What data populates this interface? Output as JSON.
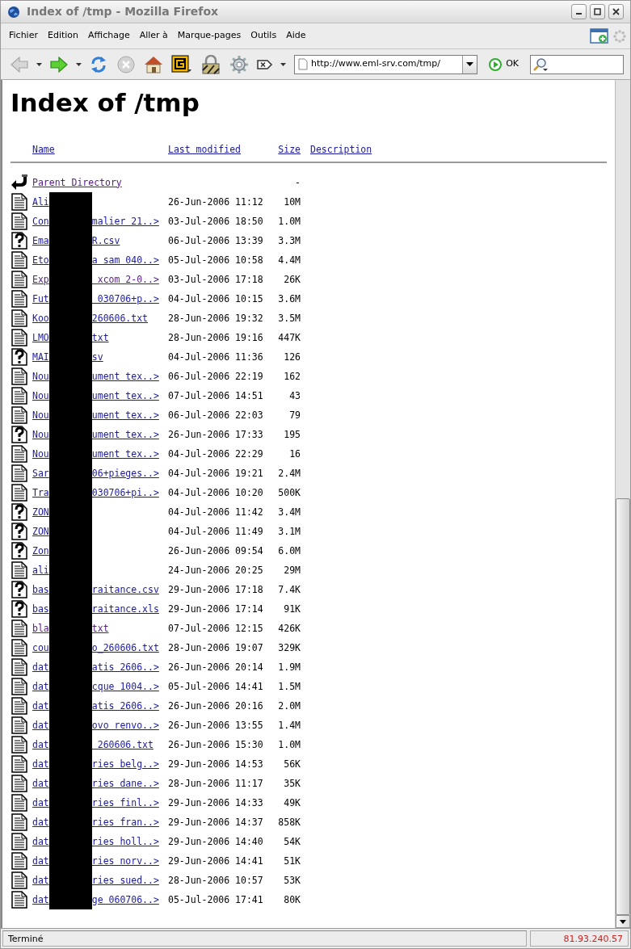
{
  "window": {
    "title": "Index of /tmp - Mozilla Firefox"
  },
  "menu": [
    "Fichier",
    "Edition",
    "Affichage",
    "Aller à",
    "Marque-pages",
    "Outils",
    "Aide"
  ],
  "toolbar": {
    "buttons": [
      {
        "kind": "back",
        "disabled": true
      },
      {
        "kind": "forward",
        "disabled": false
      },
      {
        "kind": "reload",
        "disabled": false
      },
      {
        "kind": "stop",
        "disabled": true
      },
      {
        "kind": "home",
        "disabled": false
      }
    ],
    "url": "http://www.eml-srv.com/tmp/",
    "go_label": "OK"
  },
  "page": {
    "heading": "Index of /tmp",
    "columns": [
      "Name",
      "Last modified",
      "Size",
      "Description"
    ],
    "rows": [
      {
        "kind": "back",
        "name_start": "Parent Directory",
        "name_end": "",
        "redacted": false,
        "visited": true,
        "modified": "",
        "size": "-"
      },
      {
        "kind": "text",
        "name_start": "Ali",
        "name_end": "",
        "redacted": true,
        "visited": false,
        "modified": "26-Jun-2006 11:12",
        "size": "10M"
      },
      {
        "kind": "text",
        "name_start": "Con",
        "name_end": "malier 21..>",
        "redacted": true,
        "visited": false,
        "modified": "03-Jul-2006 18:50",
        "size": "1.0M"
      },
      {
        "kind": "unknown",
        "name_start": "Ema",
        "name_end": "R.csv",
        "redacted": true,
        "visited": false,
        "modified": "06-Jul-2006 13:39",
        "size": "3.3M"
      },
      {
        "kind": "text",
        "name_start": "Eto",
        "name_end": "a sam 040..>",
        "redacted": true,
        "visited": false,
        "modified": "05-Jul-2006 10:58",
        "size": "4.4M"
      },
      {
        "kind": "text",
        "name_start": "Exp",
        "name_end": " xcom 2-0..>",
        "redacted": true,
        "visited": true,
        "modified": "03-Jul-2006 17:18",
        "size": "26K"
      },
      {
        "kind": "text",
        "name_start": "Fut",
        "name_end": " 030706+p..>",
        "redacted": true,
        "visited": false,
        "modified": "04-Jul-2006 10:15",
        "size": "3.6M"
      },
      {
        "kind": "text",
        "name_start": "Koo",
        "name_end": "260606.txt",
        "redacted": true,
        "visited": false,
        "modified": "28-Jun-2006 19:32",
        "size": "3.5M"
      },
      {
        "kind": "text",
        "name_start": "LMO",
        "name_end": "txt",
        "redacted": true,
        "visited": false,
        "modified": "28-Jun-2006 19:16",
        "size": "447K"
      },
      {
        "kind": "unknown",
        "name_start": "MAI",
        "name_end": "sv",
        "redacted": true,
        "visited": false,
        "modified": "04-Jul-2006 11:36",
        "size": "126"
      },
      {
        "kind": "text",
        "name_start": "Nou",
        "name_end": "ument tex..>",
        "redacted": true,
        "visited": false,
        "modified": "06-Jul-2006 22:19",
        "size": "162"
      },
      {
        "kind": "text",
        "name_start": "Nou",
        "name_end": "ument tex..>",
        "redacted": true,
        "visited": false,
        "modified": "07-Jul-2006 14:51",
        "size": "43"
      },
      {
        "kind": "text",
        "name_start": "Nou",
        "name_end": "ument tex..>",
        "redacted": true,
        "visited": false,
        "modified": "06-Jul-2006 22:03",
        "size": "79"
      },
      {
        "kind": "unknown",
        "name_start": "Nou",
        "name_end": "ument tex..>",
        "redacted": true,
        "visited": false,
        "modified": "26-Jun-2006 17:33",
        "size": "195"
      },
      {
        "kind": "text",
        "name_start": "Nou",
        "name_end": "ument tex..>",
        "redacted": true,
        "visited": false,
        "modified": "04-Jul-2006 22:29",
        "size": "16"
      },
      {
        "kind": "text",
        "name_start": "Sar",
        "name_end": "06+pieges..>",
        "redacted": true,
        "visited": false,
        "modified": "04-Jul-2006 19:21",
        "size": "2.4M"
      },
      {
        "kind": "text",
        "name_start": "Tra",
        "name_end": "030706+pi..>",
        "redacted": true,
        "visited": false,
        "modified": "04-Jul-2006 10:20",
        "size": "500K"
      },
      {
        "kind": "unknown",
        "name_start": "ZON",
        "name_end": "",
        "redacted": true,
        "visited": false,
        "modified": "04-Jul-2006 11:42",
        "size": "3.4M"
      },
      {
        "kind": "unknown",
        "name_start": "ZON",
        "name_end": "",
        "redacted": true,
        "visited": false,
        "modified": "04-Jul-2006 11:49",
        "size": "3.1M"
      },
      {
        "kind": "unknown",
        "name_start": "Zon",
        "name_end": "",
        "redacted": true,
        "visited": false,
        "modified": "26-Jun-2006 09:54",
        "size": "6.0M"
      },
      {
        "kind": "text",
        "name_start": "ali",
        "name_end": "",
        "redacted": true,
        "visited": false,
        "modified": "24-Jun-2006 20:25",
        "size": "29M"
      },
      {
        "kind": "unknown",
        "name_start": "bas",
        "name_end": "raitance.csv",
        "redacted": true,
        "visited": false,
        "modified": "29-Jun-2006 17:18",
        "size": "7.4K"
      },
      {
        "kind": "unknown",
        "name_start": "bas",
        "name_end": "raitance.xls",
        "redacted": true,
        "visited": false,
        "modified": "29-Jun-2006 17:14",
        "size": "91K"
      },
      {
        "kind": "text",
        "name_start": "bla",
        "name_end": "txt",
        "redacted": true,
        "visited": true,
        "modified": "07-Jul-2006 12:15",
        "size": "426K"
      },
      {
        "kind": "text",
        "name_start": "cou",
        "name_end": "o_260606.txt",
        "redacted": true,
        "visited": false,
        "modified": "28-Jun-2006 19:07",
        "size": "329K"
      },
      {
        "kind": "text",
        "name_start": "dat",
        "name_end": "atis 2606..>",
        "redacted": true,
        "visited": false,
        "modified": "26-Jun-2006 20:14",
        "size": "1.9M"
      },
      {
        "kind": "text",
        "name_start": "dat",
        "name_end": "cque 1004..>",
        "redacted": true,
        "visited": false,
        "modified": "05-Jul-2006 14:41",
        "size": "1.5M"
      },
      {
        "kind": "text",
        "name_start": "dat",
        "name_end": "atis 2606..>",
        "redacted": true,
        "visited": false,
        "modified": "26-Jun-2006 20:16",
        "size": "2.0M"
      },
      {
        "kind": "text",
        "name_start": "dat",
        "name_end": "ovo renvo..>",
        "redacted": true,
        "visited": false,
        "modified": "26-Jun-2006 13:55",
        "size": "1.4M"
      },
      {
        "kind": "text",
        "name_start": "dat",
        "name_end": " 260606.txt",
        "redacted": true,
        "visited": false,
        "modified": "26-Jun-2006 15:30",
        "size": "1.0M"
      },
      {
        "kind": "text",
        "name_start": "dat",
        "name_end": "ries belg..>",
        "redacted": true,
        "visited": false,
        "modified": "29-Jun-2006 14:53",
        "size": "56K"
      },
      {
        "kind": "text",
        "name_start": "dat",
        "name_end": "ries dane..>",
        "redacted": true,
        "visited": false,
        "modified": "28-Jun-2006 11:17",
        "size": "35K"
      },
      {
        "kind": "text",
        "name_start": "dat",
        "name_end": "ries finl..>",
        "redacted": true,
        "visited": false,
        "modified": "29-Jun-2006 14:33",
        "size": "49K"
      },
      {
        "kind": "text",
        "name_start": "dat",
        "name_end": "ries fran..>",
        "redacted": true,
        "visited": false,
        "modified": "29-Jun-2006 14:37",
        "size": "858K"
      },
      {
        "kind": "text",
        "name_start": "dat",
        "name_end": "ries holl..>",
        "redacted": true,
        "visited": false,
        "modified": "29-Jun-2006 14:40",
        "size": "54K"
      },
      {
        "kind": "text",
        "name_start": "dat",
        "name_end": "ries norv..>",
        "redacted": true,
        "visited": false,
        "modified": "29-Jun-2006 14:41",
        "size": "51K"
      },
      {
        "kind": "text",
        "name_start": "dat",
        "name_end": "ries sued..>",
        "redacted": true,
        "visited": false,
        "modified": "28-Jun-2006 10:57",
        "size": "53K"
      },
      {
        "kind": "text",
        "name_start": "dat",
        "name_end": "ge 060706..>",
        "redacted": true,
        "visited": false,
        "modified": "05-Jul-2006 17:41",
        "size": "80K"
      }
    ]
  },
  "status_bar": {
    "text": "Terminé",
    "ip": "81.93.240.57"
  }
}
